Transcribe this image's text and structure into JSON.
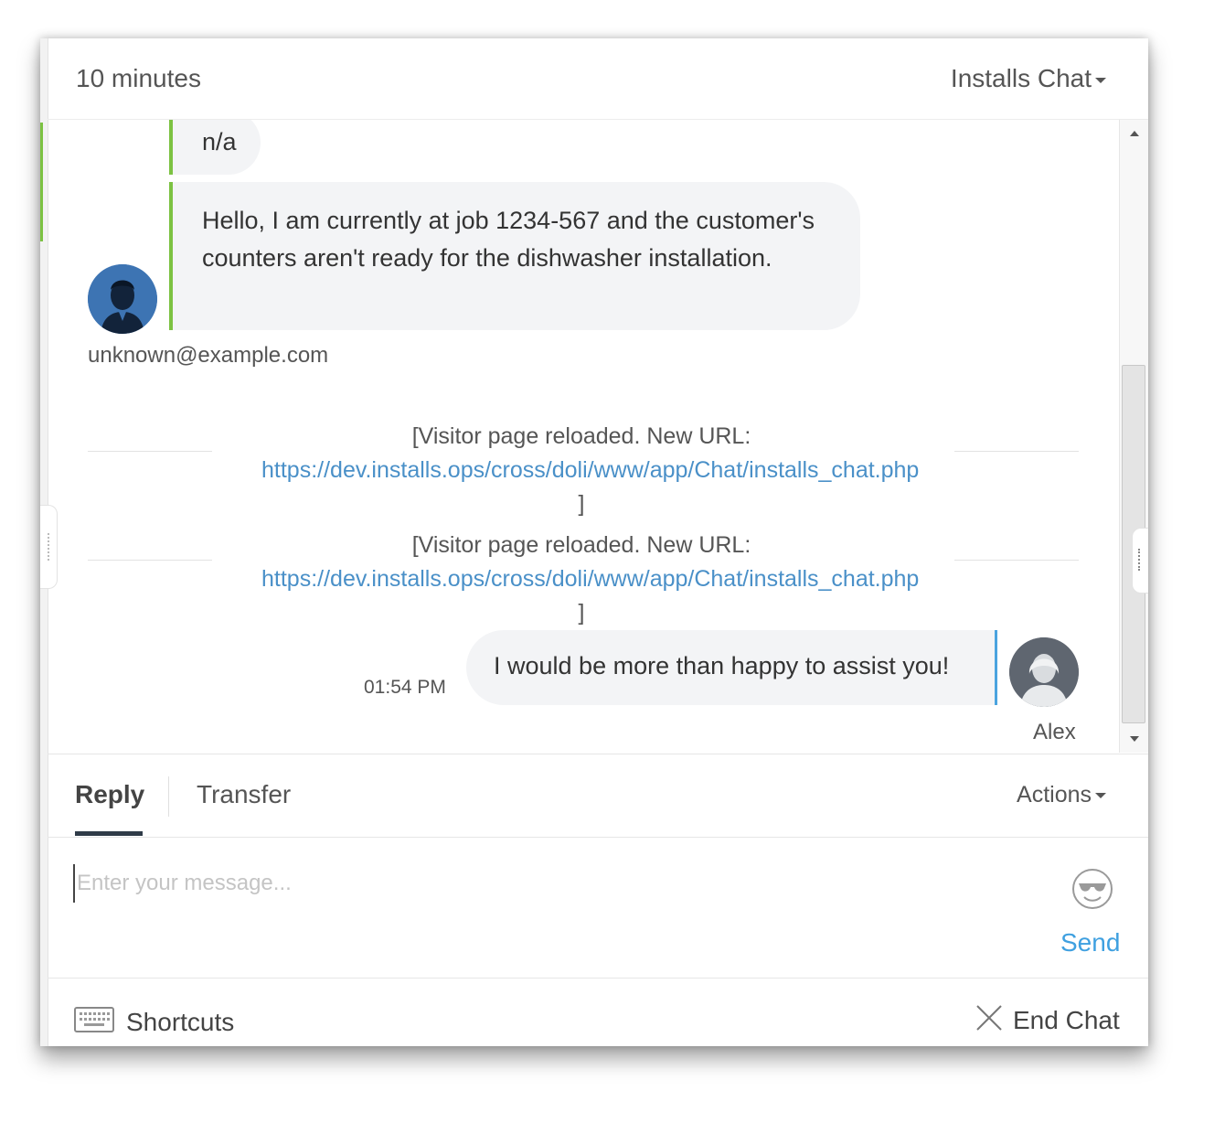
{
  "header": {
    "duration": "10 minutes",
    "chat_name": "Installs Chat"
  },
  "messages": {
    "visitor_bubble_1": "n/a",
    "visitor_bubble_2": "Hello, I am currently at job 1234-567 and the customer's counters aren't ready for the dishwasher installation.",
    "visitor_email": "unknown@example.com",
    "system_events": [
      {
        "text": "[Visitor page reloaded. New URL: ",
        "link": "https://dev.installs.ops/cross/doli/www/app/Chat/installs_chat.php",
        "suffix": " ]"
      },
      {
        "text": "[Visitor page reloaded. New URL: ",
        "link": "https://dev.installs.ops/cross/doli/www/app/Chat/installs_chat.php",
        "suffix": " ]"
      }
    ],
    "agent_time": "01:54 PM",
    "agent_bubble": "I would be more than happy to assist you!",
    "agent_name": "Alex"
  },
  "tabs": {
    "reply": "Reply",
    "transfer": "Transfer",
    "actions": "Actions",
    "active": "Reply"
  },
  "compose": {
    "placeholder": "Enter your message...",
    "value": "",
    "send": "Send"
  },
  "footer": {
    "shortcuts": "Shortcuts",
    "end_chat": "End Chat"
  },
  "icons": {
    "user_avatar": "user-avatar-icon",
    "agent_avatar": "agent-avatar-icon",
    "emoji": "sunglasses-smiley-icon",
    "keyboard": "keyboard-icon",
    "close": "close-x-icon",
    "caret": "caret-down-icon"
  },
  "colors": {
    "visitor_accent": "#7cc242",
    "agent_accent": "#4aa3df",
    "link": "#4a90c8",
    "send": "#3fa0e0"
  }
}
